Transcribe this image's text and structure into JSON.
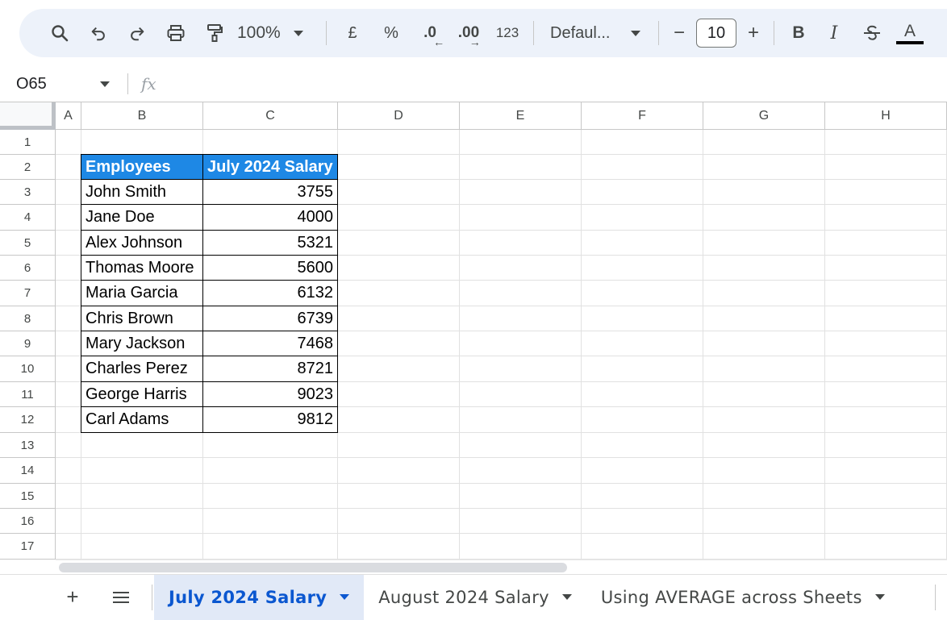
{
  "toolbar": {
    "zoom": "100%",
    "currency": "£",
    "percent": "%",
    "decrease_decimal": ".0",
    "increase_decimal": ".00",
    "number_format": "123",
    "font": "Defaul...",
    "font_size": "10",
    "minus": "−",
    "plus": "+",
    "bold": "B",
    "italic": "I",
    "text_color": "A"
  },
  "formula_bar": {
    "cell_ref": "O65",
    "fx": "fx"
  },
  "columns": [
    "A",
    "B",
    "C",
    "D",
    "E",
    "F",
    "G",
    "H"
  ],
  "rows": [
    "1",
    "2",
    "3",
    "4",
    "5",
    "6",
    "7",
    "8",
    "9",
    "10",
    "11",
    "12",
    "13",
    "14",
    "15",
    "16",
    "17"
  ],
  "table": {
    "headers": [
      "Employees",
      "July 2024 Salary"
    ],
    "rows": [
      [
        "John Smith",
        "3755"
      ],
      [
        "Jane Doe",
        "4000"
      ],
      [
        "Alex Johnson",
        "5321"
      ],
      [
        "Thomas Moore",
        "5600"
      ],
      [
        "Maria Garcia",
        "6132"
      ],
      [
        "Chris Brown",
        "6739"
      ],
      [
        "Mary Jackson",
        "7468"
      ],
      [
        "Charles Perez",
        "8721"
      ],
      [
        "George Harris",
        "9023"
      ],
      [
        "Carl Adams",
        "9812"
      ]
    ]
  },
  "sheets": {
    "add": "+",
    "list": "≡",
    "tabs": [
      "July 2024 Salary",
      "August 2024 Salary",
      "Using AVERAGE across Sheets"
    ],
    "active": 0
  },
  "colors": {
    "header_fill": "#1e88e5",
    "toolbar_bg": "#edf2fa",
    "active_tab_bg": "#e1e9f7",
    "active_tab_text": "#0b57d0"
  }
}
